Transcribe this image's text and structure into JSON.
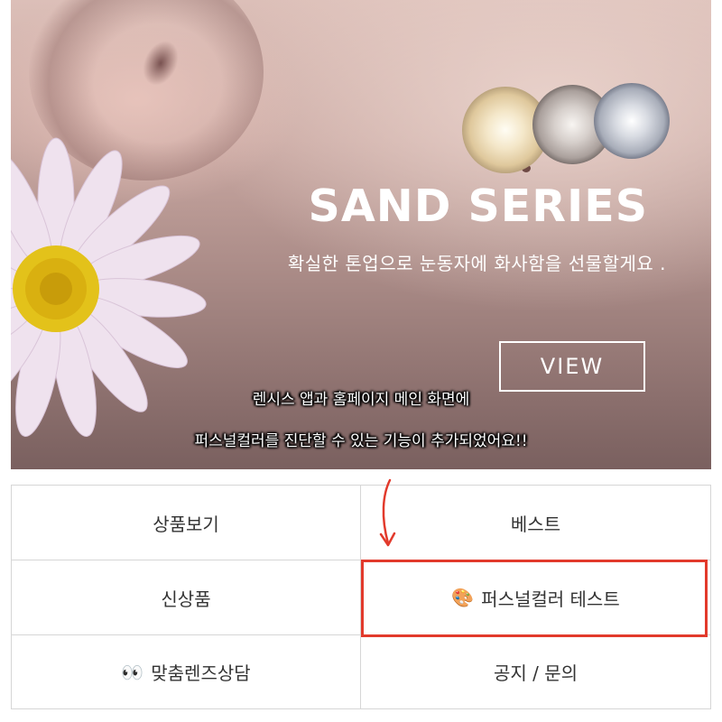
{
  "banner": {
    "title": "SAND SERIES",
    "subtitle": "확실한 톤업으로 눈동자에 화사함을 선물할게요 .",
    "view_label": "VIEW",
    "annotation_line1": "렌시스 앱과 홈페이지 메인 화면에",
    "annotation_line2": "퍼스널컬러를 진단할 수 있는 기능이 추가되었어요!!"
  },
  "menu": {
    "items": [
      {
        "label": "상품보기"
      },
      {
        "label": "베스트"
      },
      {
        "label": "신상품"
      },
      {
        "label": "퍼스널컬러 테스트",
        "icon": "🎨"
      },
      {
        "label": "맞춤렌즈상담",
        "icon": "👀"
      },
      {
        "label": "공지 / 문의"
      }
    ]
  },
  "colors": {
    "highlight": "#e23a2c",
    "text": "#333333",
    "border": "#d6d6d6"
  }
}
